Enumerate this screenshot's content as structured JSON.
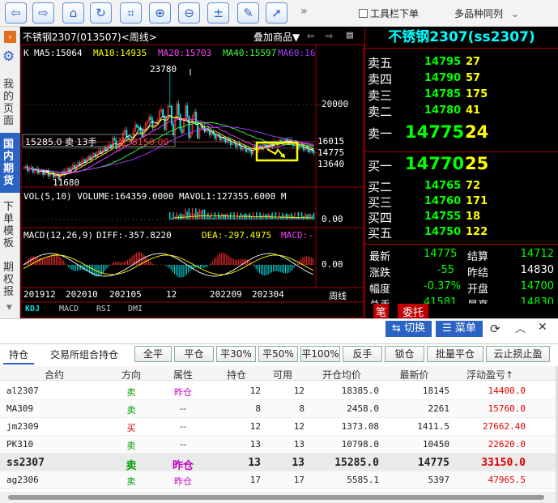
{
  "toolbar": {
    "buttons": [
      "back-icon",
      "forward-icon",
      "home-icon",
      "refresh-icon",
      "crop-icon",
      "zoom-in-icon",
      "zoom-out-icon",
      "calculator-icon",
      "pen-icon",
      "pointer-icon"
    ],
    "overflow": "»",
    "toolbar_checkbox_label": "工具栏下单",
    "multi_variety_label": "多品种同列"
  },
  "sidebar": {
    "items": [
      "我的页面",
      "国内期货",
      "下单模板",
      "期权报"
    ]
  },
  "chart": {
    "title": "不锈钢2307(013507)<周线>",
    "overlay_menu": "叠加商品▼",
    "ma_line": {
      "k": "K",
      "ma5": "MA5:15064",
      "ma10": "MA10:14935",
      "ma20": "MA20:15703",
      "ma40": "MA40:15597",
      "ma60": "MA60:16"
    },
    "high_label": "23780",
    "low_label": "11680",
    "y_labels": [
      "20000",
      "16015",
      "14775",
      "13640"
    ],
    "position_label": "15285.0  卖 13手",
    "profit_label": "盈33150.00",
    "vol_line": "VOL(5,10) VOLUME:164359.0000 MAVOL1:127355.6000 M",
    "vol_zero": "0.00",
    "macd_line": {
      "label": "MACD(12,26,9)",
      "diff": "DIFF:-357.8220",
      "dea": "DEA:-297.4975",
      "macd": "MACD:-"
    },
    "macd_zero": "0.00",
    "x_labels": [
      "201912",
      "202010",
      "202105",
      "12",
      "202209",
      "202304"
    ],
    "period_label": "周线",
    "tabs": [
      "KDJ",
      "MACD",
      "RSI",
      "DMI"
    ]
  },
  "quote": {
    "title": "不锈钢2307(ss2307)",
    "sells": [
      {
        "label": "卖五",
        "price": "14795",
        "vol": "27"
      },
      {
        "label": "卖四",
        "price": "14790",
        "vol": "57"
      },
      {
        "label": "卖三",
        "price": "14785",
        "vol": "175"
      },
      {
        "label": "卖二",
        "price": "14780",
        "vol": "41"
      }
    ],
    "sell1": {
      "label": "卖一",
      "price": "14775",
      "vol": "24"
    },
    "buy1": {
      "label": "买一",
      "price": "14770",
      "vol": "25"
    },
    "buys": [
      {
        "label": "买二",
        "price": "14765",
        "vol": "72"
      },
      {
        "label": "买三",
        "price": "14760",
        "vol": "171"
      },
      {
        "label": "买四",
        "price": "14755",
        "vol": "18"
      },
      {
        "label": "买五",
        "price": "14750",
        "vol": "122"
      }
    ],
    "stats": [
      {
        "l1": "最新",
        "v1": "14775",
        "l2": "结算",
        "v2": "14712"
      },
      {
        "l1": "涨跌",
        "v1": "-55",
        "l2": "昨结",
        "v2": "14830"
      },
      {
        "l1": "幅度",
        "v1": "-0.37%",
        "l2": "开盘",
        "v2": "14700"
      },
      {
        "l1": "总手",
        "v1": "41581",
        "l2": "最高",
        "v2": "14830"
      }
    ],
    "tabs": [
      "笔",
      "委托"
    ]
  },
  "panel": {
    "switch_button": "⇆ 切换",
    "menu_button": "☰ 菜单",
    "tabs": [
      "持仓",
      "交易所组合持仓"
    ],
    "actions": [
      "全平",
      "平仓",
      "平30%",
      "平50%",
      "平100%",
      "反手",
      "锁仓",
      "批量平仓",
      "云止损止盈"
    ],
    "columns": [
      "合约",
      "方向",
      "属性",
      "持仓",
      "可用",
      "开仓均价",
      "最新价",
      "浮动盈亏↑"
    ],
    "rows": [
      {
        "contract": "al2307",
        "dir": "卖",
        "attr": "昨仓",
        "pos": "12",
        "avail": "12",
        "avg": "18385.0",
        "last": "18145",
        "pnl": "14400.0",
        "sell": true,
        "bold": false
      },
      {
        "contract": "MA309",
        "dir": "卖",
        "attr": "--",
        "pos": "8",
        "avail": "8",
        "avg": "2458.0",
        "last": "2261",
        "pnl": "15760.0",
        "sell": true,
        "bold": false
      },
      {
        "contract": "jm2309",
        "dir": "买",
        "attr": "--",
        "pos": "12",
        "avail": "12",
        "avg": "1373.08",
        "last": "1411.5",
        "pnl": "27662.40",
        "sell": false,
        "bold": false
      },
      {
        "contract": "PK310",
        "dir": "卖",
        "attr": "--",
        "pos": "13",
        "avail": "13",
        "avg": "10798.0",
        "last": "10450",
        "pnl": "22620.0",
        "sell": true,
        "bold": false
      },
      {
        "contract": "ss2307",
        "dir": "卖",
        "attr": "昨仓",
        "pos": "13",
        "avail": "13",
        "avg": "15285.0",
        "last": "14775",
        "pnl": "33150.0",
        "sell": true,
        "bold": true
      },
      {
        "contract": "ag2306",
        "dir": "卖",
        "attr": "昨仓",
        "pos": "17",
        "avail": "17",
        "avg": "5585.1",
        "last": "5397",
        "pnl": "47965.5",
        "sell": true,
        "bold": false
      }
    ]
  },
  "colors": {
    "up": "#ff3030",
    "down": "#00e0e0",
    "quote_green": "#00ff00",
    "quote_yellow": "#ffff00",
    "panel_blue": "#2a63c4"
  }
}
